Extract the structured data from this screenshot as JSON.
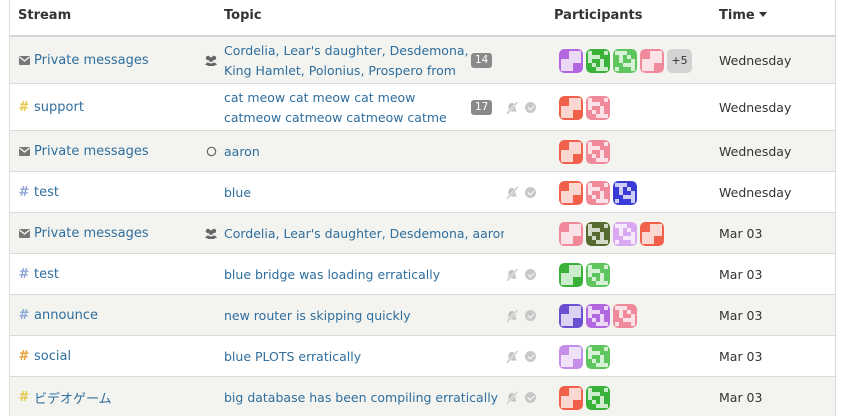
{
  "header": {
    "stream": "Stream",
    "topic": "Topic",
    "participants": "Participants",
    "time": "Time"
  },
  "colors": {
    "link": "#2f6e9e",
    "stream_hash_yellow": "#e6c84a",
    "stream_hash_blue": "#8fa6d6",
    "stream_hash_orange": "#e8a33b",
    "badge": "#8a8a8a"
  },
  "rows": [
    {
      "stream": "Private messages",
      "stream_icon": "envelope-icon",
      "topic_icon": "group-icon",
      "topic": "Cordelia, Lear's daughter, Desdemona, King Hamlet, Polonius, Prospero from T…",
      "unread": "14",
      "muted_icon": false,
      "participants": [
        "#b266e0",
        "#3ab23a",
        "#5fc65f",
        "#f08a9a"
      ],
      "more": "+5",
      "time": "Wednesday"
    },
    {
      "stream": "support",
      "stream_icon": "hash-icon-yellow",
      "topic": "cat meow cat meow cat meow catmeow catmeow catmeow catme",
      "unread": "17",
      "muted_icon": true,
      "participants": [
        "#f0604a",
        "#f08a9a"
      ],
      "time": "Wednesday"
    },
    {
      "stream": "Private messages",
      "stream_icon": "envelope-icon",
      "topic_icon": "user-circle-icon",
      "topic": "aaron",
      "participants": [
        "#f0604a",
        "#f08a9a"
      ],
      "time": "Wednesday"
    },
    {
      "stream": "test",
      "stream_icon": "hash-icon-blue",
      "topic": "blue",
      "muted_icon": true,
      "participants": [
        "#f0604a",
        "#f08a9a",
        "#3a3ad6"
      ],
      "time": "Wednesday"
    },
    {
      "stream": "Private messages",
      "stream_icon": "envelope-icon",
      "topic_icon": "group-icon",
      "topic": "Cordelia, Lear's daughter, Desdemona, aaron",
      "participants": [
        "#f08a9a",
        "#556b2f",
        "#d9a8f0",
        "#f0604a"
      ],
      "time": "Mar 03"
    },
    {
      "stream": "test",
      "stream_icon": "hash-icon-blue",
      "topic": "blue bridge was loading erratically",
      "muted_icon": true,
      "participants": [
        "#3ab23a",
        "#5fc65f"
      ],
      "time": "Mar 03"
    },
    {
      "stream": "announce",
      "stream_icon": "hash-icon-blue",
      "topic": "new router is skipping quickly",
      "muted_icon": true,
      "participants": [
        "#6b4fd0",
        "#b266e0",
        "#f08a9a"
      ],
      "time": "Mar 03"
    },
    {
      "stream": "social",
      "stream_icon": "hash-icon-orange",
      "topic": "blue PLOTS erratically",
      "muted_icon": true,
      "participants": [
        "#c48de8",
        "#5fc65f"
      ],
      "time": "Mar 03"
    },
    {
      "stream": "ビデオゲーム",
      "stream_icon": "hash-icon-yellow",
      "topic": "big database has been compiling erratically",
      "muted_icon": true,
      "participants": [
        "#f0604a",
        "#3ab23a"
      ],
      "time": "Mar 03"
    }
  ]
}
